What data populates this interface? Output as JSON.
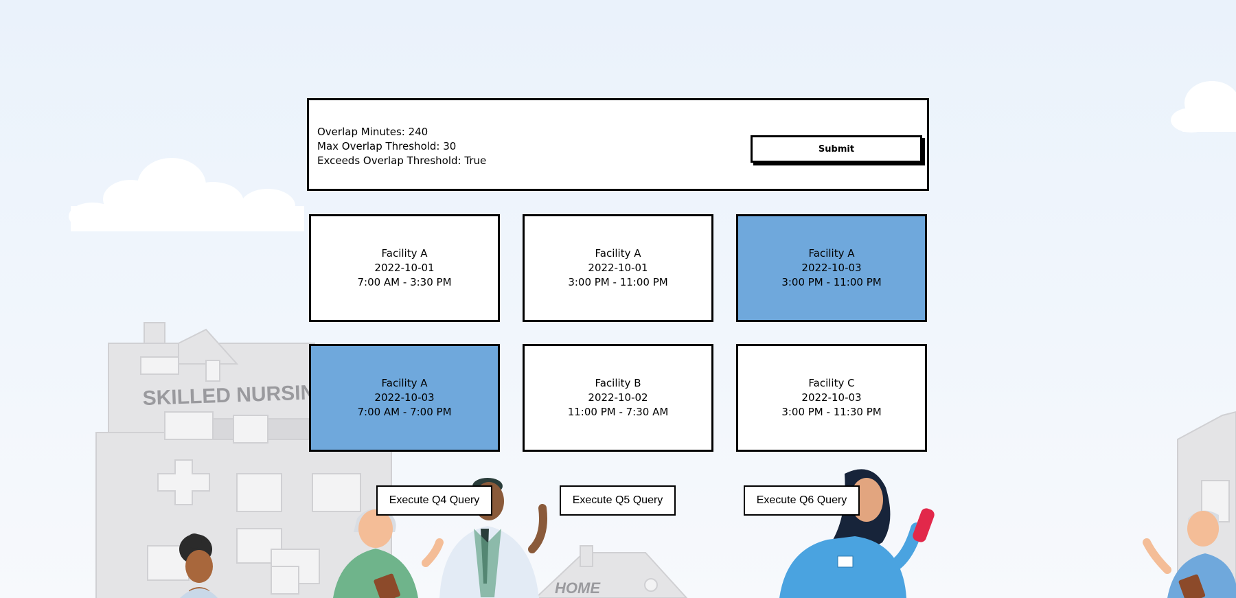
{
  "info": {
    "overlap_minutes": "Overlap Minutes: 240",
    "max_threshold": "Max Overlap Threshold: 30",
    "exceeds": "Exceeds Overlap Threshold: True",
    "submit_label": "Submit"
  },
  "shifts": [
    {
      "facility": "Facility A",
      "date": "2022-10-01",
      "time": "7:00 AM - 3:30 PM",
      "selected": false
    },
    {
      "facility": "Facility A",
      "date": "2022-10-01",
      "time": "3:00 PM - 11:00 PM",
      "selected": false
    },
    {
      "facility": "Facility A",
      "date": "2022-10-03",
      "time": "3:00 PM - 11:00 PM",
      "selected": true
    },
    {
      "facility": "Facility A",
      "date": "2022-10-03",
      "time": "7:00 AM - 7:00 PM",
      "selected": true
    },
    {
      "facility": "Facility B",
      "date": "2022-10-02",
      "time": "11:00 PM - 7:30 AM",
      "selected": false
    },
    {
      "facility": "Facility C",
      "date": "2022-10-03",
      "time": "3:00 PM - 11:30 PM",
      "selected": false
    }
  ],
  "queries": {
    "q4_label": "Execute Q4 Query",
    "q5_label": "Execute Q5 Query",
    "q6_label": "Execute Q6 Query"
  },
  "background": {
    "building_sign": "SKILLED NURSIN",
    "house_sign": "HOME"
  },
  "colors": {
    "selected_card": "#6fa8dc",
    "card": "#ffffff"
  }
}
